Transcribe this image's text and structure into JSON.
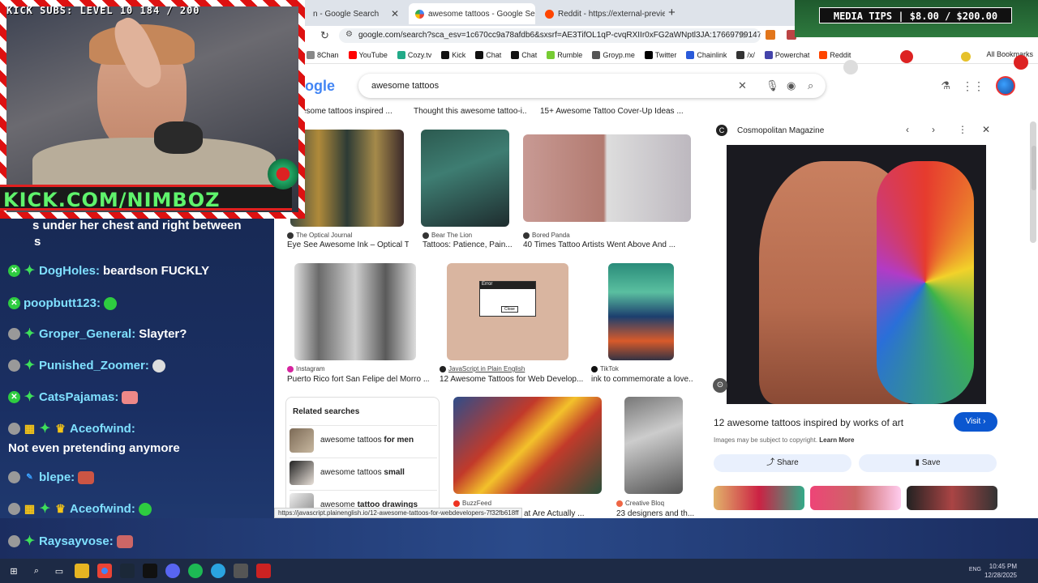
{
  "browser": {
    "tabs": [
      {
        "label": "n - Google Search",
        "active": false
      },
      {
        "label": "awesome tattoos - Google Sea",
        "active": true
      },
      {
        "label": "Reddit - https://external-previe",
        "active": false
      }
    ],
    "new_tab": "+",
    "url": "google.com/search?sca_esv=1c670cc9a78afdb6&sxsrf=AE3TifOL1qP-cvqRXIIr0xFG2aWNptl3JA:176697991476...",
    "bookmarks": [
      "8Chan",
      "YouTube",
      "Cozy.tv",
      "Kick",
      "Chat",
      "Chat",
      "Rumble",
      "Groyp.me",
      "Twitter",
      "Chainlink",
      "/x/",
      "Powerchat",
      "Reddit"
    ],
    "all_bookmarks": "All Bookmarks"
  },
  "google": {
    "logo": "ogle",
    "query": "awesome tattoos"
  },
  "top_titles": [
    "esome tattoos inspired ...",
    "Thought this awesome tattoo-i...",
    "15+ Awesome Tattoo Cover-Up Ideas ..."
  ],
  "results": [
    {
      "source": "The Optical Journal",
      "title": "Eye See Awesome Ink – Optical T..."
    },
    {
      "source": "Bear The Lion",
      "title": "Tattoos: Patience, Pain..."
    },
    {
      "source": "Bored Panda",
      "title": "40 Times Tattoo Artists Went Above And ..."
    },
    {
      "source": "Instagram",
      "title": "Puerto Rico fort San Felipe del Morro ..."
    },
    {
      "source": "JavaScript in Plain English",
      "title": "12 Awesome Tattoos for Web Develop..."
    },
    {
      "source": "TikTok",
      "title": "ink to commemorate a love..."
    },
    {
      "source": "BuzzFeed",
      "title": "at Are Actually ..."
    },
    {
      "source": "Creative Bloq",
      "title": "23 designers and th..."
    }
  ],
  "error_dialog": {
    "title": "Error",
    "button": "Close"
  },
  "related": {
    "heading": "Related searches",
    "items": [
      {
        "base": "awesome tattoos",
        "bold": "for men"
      },
      {
        "base": "awesome tattoos",
        "bold": "small"
      },
      {
        "base": "awesome",
        "bold": "tattoo drawings"
      }
    ]
  },
  "status_url": "https://javascript.plainenglish.io/12-awesome-tattoos-for-webdevelopers-7f32fb618ff",
  "panel": {
    "source": "Cosmopolitan Magazine",
    "title": "12 awesome tattoos inspired by works of art",
    "visit": "Visit",
    "copyright": "Images may be subject to copyright.",
    "learn_more": "Learn More",
    "share": "Share",
    "save": "Save"
  },
  "stream": {
    "kick_subs": "KICK SUBS: LEVEL 10 184 / 200",
    "banner": "KICK.COM/NIMBOZ",
    "media_tips": "MEDIA TIPS | $8.00 / $200.00"
  },
  "chat": [
    {
      "user": "",
      "text": "s under her chest and right between"
    },
    {
      "user": "",
      "text": "s"
    },
    {
      "user": "DogHoles:",
      "text": "beardson FUCKLY"
    },
    {
      "user": "poopbutt123:",
      "text": ""
    },
    {
      "user": "Groper_General:",
      "text": "Slayter?"
    },
    {
      "user": "Punished_Zoomer:",
      "text": ""
    },
    {
      "user": "CatsPajamas:",
      "text": ""
    },
    {
      "user": "Aceofwind:",
      "text": ""
    },
    {
      "user": "",
      "text": "Not even pretending anymore"
    },
    {
      "user": "blepe:",
      "text": ""
    },
    {
      "user": "Aceofwind:",
      "text": ""
    },
    {
      "user": "Raysayvose:",
      "text": ""
    }
  ],
  "taskbar": {
    "lang": "ENG",
    "time": "10:45 PM",
    "date": "12/28/2025"
  },
  "colors": {
    "accent": "#0b57d0",
    "chat_user": "#7fe0ff",
    "banner_text": "#5ff36c",
    "candy_red": "#dd1111"
  }
}
